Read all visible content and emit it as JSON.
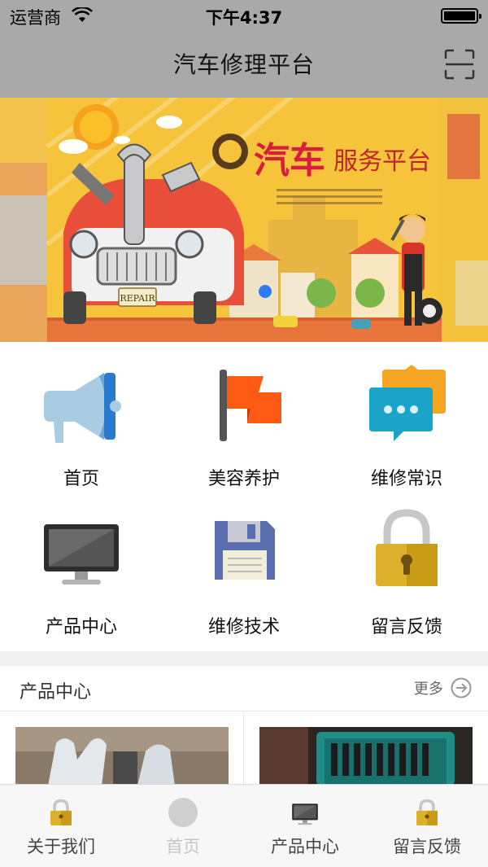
{
  "status_bar": {
    "carrier": "运营商",
    "time": "下午4:37"
  },
  "nav": {
    "title": "汽车修理平台",
    "scan_icon": "scan-icon"
  },
  "banner": {
    "brand_big": "汽车",
    "brand_small": "服务平台",
    "plate_text": "REPAIR"
  },
  "menu": {
    "items": [
      {
        "label": "首页",
        "icon": "megaphone-icon"
      },
      {
        "label": "美容养护",
        "icon": "flag-icon"
      },
      {
        "label": "维修常识",
        "icon": "chat-bubble-icon"
      },
      {
        "label": "产品中心",
        "icon": "monitor-icon"
      },
      {
        "label": "维修技术",
        "icon": "floppy-disk-icon"
      },
      {
        "label": "留言反馈",
        "icon": "lock-icon"
      }
    ]
  },
  "products": {
    "title": "产品中心",
    "more": "更多"
  },
  "tabbar": {
    "tabs": [
      {
        "label": "关于我们",
        "icon": "lock-icon"
      },
      {
        "label": "首页",
        "icon": "home-circle-icon"
      },
      {
        "label": "产品中心",
        "icon": "monitor-icon"
      },
      {
        "label": "留言反馈",
        "icon": "lock-icon"
      }
    ],
    "active_index": 1
  },
  "colors": {
    "accent_yellow": "#f5c542",
    "nav_gray": "#a9a9a9",
    "brand_red": "#d81e3c"
  }
}
